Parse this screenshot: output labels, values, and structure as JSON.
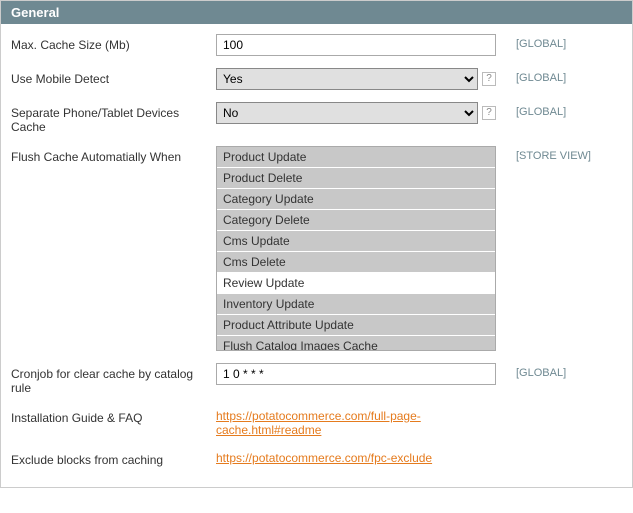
{
  "header": {
    "title": "General"
  },
  "fields": {
    "max_cache": {
      "label": "Max. Cache Size (Mb)",
      "value": "100",
      "scope": "[GLOBAL]"
    },
    "mobile_detect": {
      "label": "Use Mobile Detect",
      "value": "Yes",
      "scope": "[GLOBAL]"
    },
    "separate_cache": {
      "label": "Separate Phone/Tablet Devices Cache",
      "value": "No",
      "scope": "[GLOBAL]"
    },
    "flush": {
      "label": "Flush Cache Automatially When",
      "scope": "[STORE VIEW]",
      "options": [
        "Product Update",
        "Product Delete",
        "Category Update",
        "Category Delete",
        "Cms Update",
        "Cms Delete",
        "Review Update",
        "Inventory Update",
        "Product Attribute Update",
        "Flush Catalog Images Cache"
      ],
      "selected_index": 6
    },
    "cronjob": {
      "label": "Cronjob for clear cache by catalog rule",
      "value": "1 0 * * *",
      "scope": "[GLOBAL]"
    },
    "install": {
      "label": "Installation Guide & FAQ",
      "link": "https://potatocommerce.com/full-page-cache.html#readme"
    },
    "exclude": {
      "label": "Exclude blocks from caching",
      "link": "https://potatocommerce.com/fpc-exclude"
    }
  }
}
